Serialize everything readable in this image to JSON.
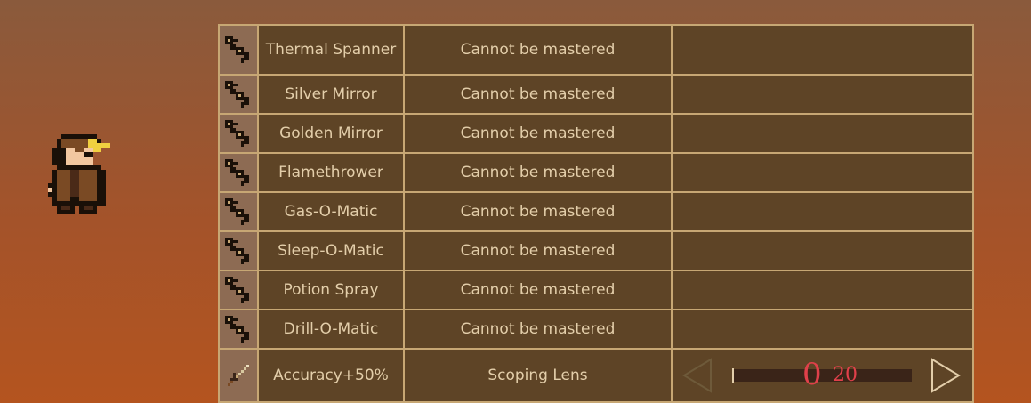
{
  "character": {
    "icon": "steampunk-adventurer-sprite"
  },
  "rows": [
    {
      "icon": "spanner-icon",
      "name": "Thermal Spanner",
      "mastery": "Cannot be mastered"
    },
    {
      "icon": "spanner-icon",
      "name": "Silver Mirror",
      "mastery": "Cannot be mastered"
    },
    {
      "icon": "spanner-icon",
      "name": "Golden Mirror",
      "mastery": "Cannot be mastered"
    },
    {
      "icon": "spanner-icon",
      "name": "Flamethrower",
      "mastery": "Cannot be mastered"
    },
    {
      "icon": "spanner-icon",
      "name": "Gas-O-Matic",
      "mastery": "Cannot be mastered"
    },
    {
      "icon": "spanner-icon",
      "name": "Sleep-O-Matic",
      "mastery": "Cannot be mastered"
    },
    {
      "icon": "spanner-icon",
      "name": "Potion Spray",
      "mastery": "Cannot be mastered"
    },
    {
      "icon": "spanner-icon",
      "name": "Drill-O-Matic",
      "mastery": "Cannot be mastered"
    }
  ],
  "upgrade_row": {
    "icon": "dagger-icon",
    "name": "Accuracy+50%",
    "item": "Scoping Lens",
    "current": "0",
    "max": "20"
  },
  "colors": {
    "table_bg": "#5e4426",
    "border": "#c7a774",
    "text": "#e3ceaa",
    "counter": "#e0404a"
  }
}
